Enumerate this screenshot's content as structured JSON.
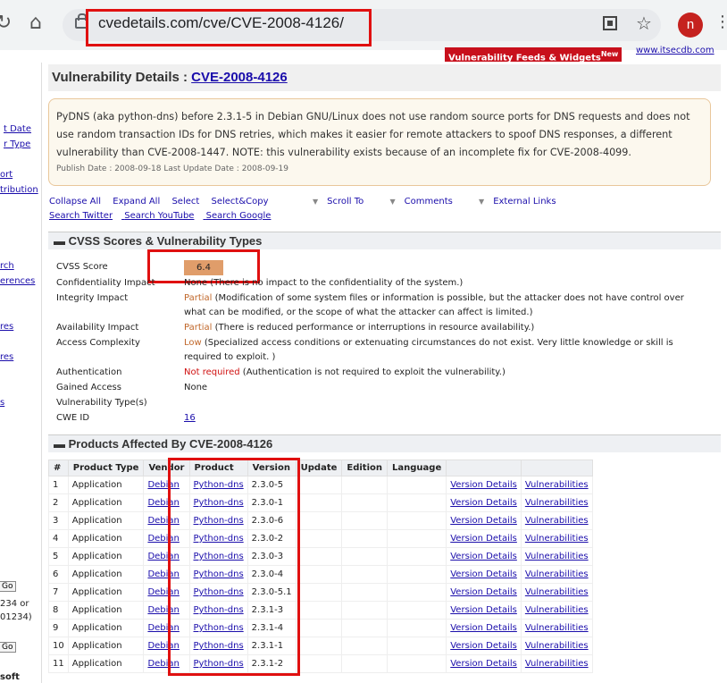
{
  "browser": {
    "url": "cvedetails.com/cve/CVE-2008-4126/",
    "avatar_letter": "n"
  },
  "sidebar": {
    "frag1": "t Date",
    "frag2": "r Type",
    "frag3": "ort",
    "frag4": "tribution",
    "frag5": "rch",
    "frag6": "erences",
    "frag7": "res",
    "frag8": "res",
    "frag9": "s",
    "go1": "Go",
    "frag10": "234 or",
    "frag11": "01234)",
    "go2": "Go",
    "frag12": "soft"
  },
  "top_links": {
    "feeds": "Vulnerability Feeds & Widgets",
    "feeds_badge": "New",
    "itsecdb": "www.itsecdb.com"
  },
  "page": {
    "title_prefix": "Vulnerability Details : ",
    "cve_id": "CVE-2008-4126",
    "description": "PyDNS (aka python-dns) before 2.3.1-5 in Debian GNU/Linux does not use random source ports for DNS requests and does not use random transaction IDs for DNS retries, which makes it easier for remote attackers to spoof DNS responses, a different vulnerability than CVE-2008-1447. NOTE: this vulnerability exists because of an incomplete fix for CVE-2008-4099.",
    "dates": "Publish Date : 2008-09-18 Last Update Date : 2008-09-19"
  },
  "actions": {
    "collapse_all": "Collapse All",
    "expand_all": "Expand All",
    "select": "Select",
    "select_copy": "Select&Copy",
    "scroll_to": "Scroll To",
    "comments": "Comments",
    "external_links": "External Links",
    "search_twitter": "Search Twitter",
    "search_youtube": "Search YouTube",
    "search_google": "Search Google"
  },
  "cvss": {
    "section_title": "CVSS Scores & Vulnerability Types",
    "score_label": "CVSS Score",
    "score": "6.4",
    "conf_label": "Confidentiality Impact",
    "conf_value": "None",
    "conf_desc": "(There is no impact to the confidentiality of the system.)",
    "integ_label": "Integrity Impact",
    "integ_value": "Partial",
    "integ_desc": "(Modification of some system files or information is possible, but the attacker does not have control over what can be modified, or the scope of what the attacker can affect is limited.)",
    "avail_label": "Availability Impact",
    "avail_value": "Partial",
    "avail_desc": "(There is reduced performance or interruptions in resource availability.)",
    "access_label": "Access Complexity",
    "access_value": "Low",
    "access_desc": "(Specialized access conditions or extenuating circumstances do not exist. Very little knowledge or skill is required to exploit. )",
    "auth_label": "Authentication",
    "auth_value": "Not required",
    "auth_desc": "(Authentication is not required to exploit the vulnerability.)",
    "gained_label": "Gained Access",
    "gained_value": "None",
    "vtype_label": "Vulnerability Type(s)",
    "cwe_label": "CWE ID",
    "cwe_value": "16"
  },
  "products": {
    "section_title": "Products Affected By CVE-2008-4126",
    "headers": [
      "#",
      "Product Type",
      "Vendor",
      "Product",
      "Version",
      "Update",
      "Edition",
      "Language",
      "",
      ""
    ],
    "link_version_details": "Version Details",
    "link_vulnerabilities": "Vulnerabilities",
    "rows": [
      {
        "n": "1",
        "type": "Application",
        "vendor": "Debian",
        "product": "Python-dns",
        "version": "2.3.0-5"
      },
      {
        "n": "2",
        "type": "Application",
        "vendor": "Debian",
        "product": "Python-dns",
        "version": "2.3.0-1"
      },
      {
        "n": "3",
        "type": "Application",
        "vendor": "Debian",
        "product": "Python-dns",
        "version": "2.3.0-6"
      },
      {
        "n": "4",
        "type": "Application",
        "vendor": "Debian",
        "product": "Python-dns",
        "version": "2.3.0-2"
      },
      {
        "n": "5",
        "type": "Application",
        "vendor": "Debian",
        "product": "Python-dns",
        "version": "2.3.0-3"
      },
      {
        "n": "6",
        "type": "Application",
        "vendor": "Debian",
        "product": "Python-dns",
        "version": "2.3.0-4"
      },
      {
        "n": "7",
        "type": "Application",
        "vendor": "Debian",
        "product": "Python-dns",
        "version": "2.3.0-5.1"
      },
      {
        "n": "8",
        "type": "Application",
        "vendor": "Debian",
        "product": "Python-dns",
        "version": "2.3.1-3"
      },
      {
        "n": "9",
        "type": "Application",
        "vendor": "Debian",
        "product": "Python-dns",
        "version": "2.3.1-4"
      },
      {
        "n": "10",
        "type": "Application",
        "vendor": "Debian",
        "product": "Python-dns",
        "version": "2.3.1-1"
      },
      {
        "n": "11",
        "type": "Application",
        "vendor": "Debian",
        "product": "Python-dns",
        "version": "2.3.1-2"
      }
    ]
  },
  "colors": {
    "highlight_red": "#e01010",
    "score_bg": "#e09d6a",
    "link": "#1a0dab",
    "partial": "#c0672a",
    "not_required": "#d01010"
  },
  "icons": [
    "reload-icon",
    "home-icon",
    "lock-icon",
    "qr-code-icon",
    "star-icon",
    "menu-dots-icon"
  ]
}
